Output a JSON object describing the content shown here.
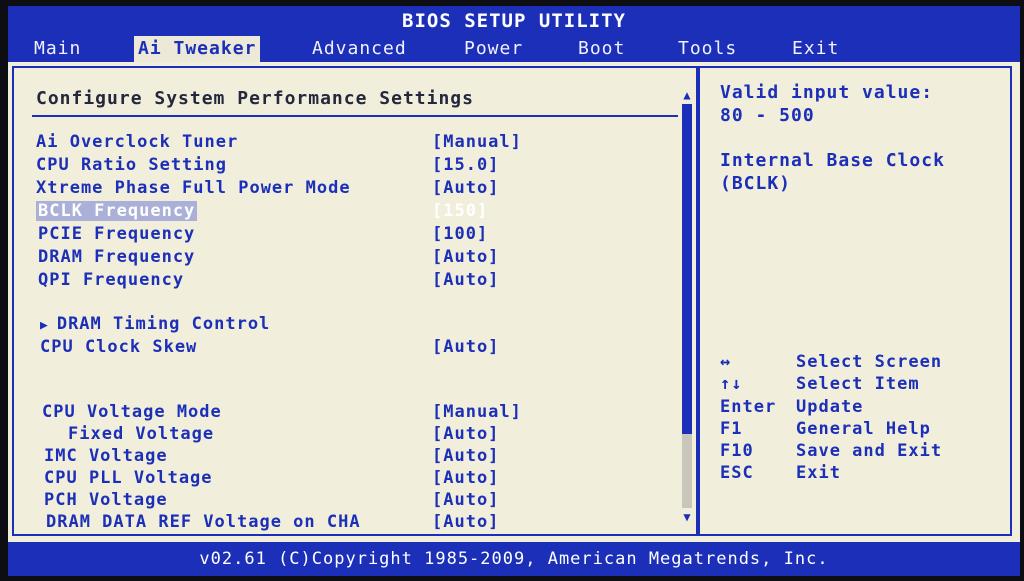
{
  "title": "BIOS SETUP UTILITY",
  "menu": [
    "Main",
    "Ai Tweaker",
    "Advanced",
    "Power",
    "Boot",
    "Tools",
    "Exit"
  ],
  "active_menu": "Ai Tweaker",
  "section_title": "Configure System Performance Settings",
  "settings": [
    {
      "label": "Ai Overclock Tuner",
      "value": "[Manual]"
    },
    {
      "label": "CPU Ratio Setting",
      "value": "[15.0]"
    },
    {
      "label": "Xtreme Phase Full Power Mode",
      "value": "[Auto]"
    },
    {
      "label": "BCLK Frequency",
      "value": "[150]",
      "selected": true
    },
    {
      "label": "PCIE Frequency",
      "value": "[100]"
    },
    {
      "label": "DRAM Frequency",
      "value": "[Auto]"
    },
    {
      "label": "QPI Frequency",
      "value": "[Auto]"
    },
    {
      "label": "DRAM Timing Control",
      "value": "",
      "submenu": true
    },
    {
      "label": "CPU Clock Skew",
      "value": "[Auto]"
    },
    {
      "label": "CPU Voltage Mode",
      "value": "[Manual]"
    },
    {
      "label": "Fixed Voltage",
      "value": "[Auto]",
      "indent": true
    },
    {
      "label": "IMC Voltage",
      "value": "[Auto]"
    },
    {
      "label": "CPU PLL Voltage",
      "value": "[Auto]"
    },
    {
      "label": "PCH Voltage",
      "value": "[Auto]"
    },
    {
      "label": "DRAM DATA REF Voltage on CHA",
      "value": "[Auto]"
    }
  ],
  "help": {
    "valid_input_label": "Valid input value:",
    "valid_input_range": "80 - 500",
    "description_line1": "Internal Base Clock",
    "description_line2": "(BCLK)"
  },
  "keys": [
    {
      "key": "↔",
      "desc": "Select Screen"
    },
    {
      "key": "↑↓",
      "desc": "Select Item"
    },
    {
      "key": "Enter",
      "desc": "Update"
    },
    {
      "key": "F1",
      "desc": "General Help"
    },
    {
      "key": "F10",
      "desc": "Save and Exit"
    },
    {
      "key": "ESC",
      "desc": "Exit"
    }
  ],
  "copyright": "v02.61 (C)Copyright 1985-2009, American Megatrends, Inc.",
  "colors": {
    "primary_blue": "#1b2fb8",
    "background": "#f2eedc",
    "text_on_blue": "#ffffff"
  }
}
